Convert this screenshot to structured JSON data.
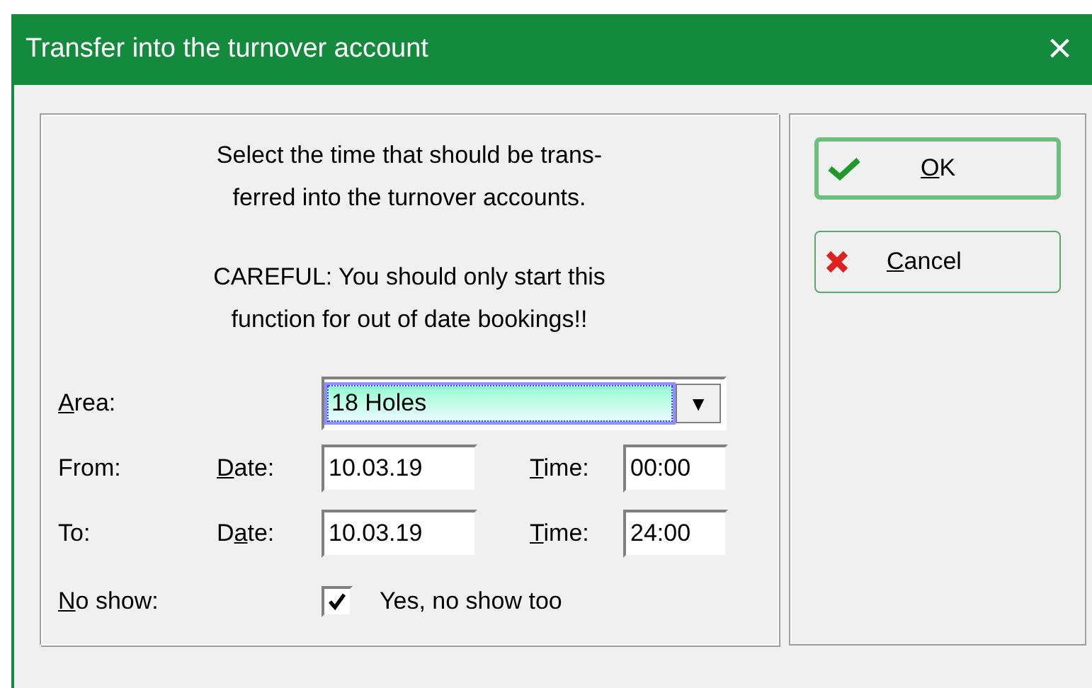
{
  "window": {
    "title": "Transfer into the turnover account",
    "close": "×"
  },
  "message": [
    [
      "Select the time that should be trans-",
      "ferred into the turnover accounts."
    ],
    [
      "CAREFUL: You should only start this",
      "function for out of date bookings!!"
    ]
  ],
  "area": {
    "label": {
      "key": "A",
      "post": "rea:"
    },
    "value": "18 Holes",
    "arrow": "▼"
  },
  "ranges": [
    {
      "label": "From:",
      "date_label": {
        "key": "D",
        "post": "ate:"
      },
      "date": "10.03.19",
      "time_label": {
        "key": "T",
        "post": "ime:"
      },
      "time": "00:00"
    },
    {
      "label": "To:",
      "date_label": {
        "pre": "D",
        "key": "a",
        "post": "te:"
      },
      "date": "10.03.19",
      "time_label": {
        "key": "T",
        "post": "ime:"
      },
      "time": "24:00"
    }
  ],
  "no_show": {
    "label": {
      "key": "N",
      "post": "o show:"
    },
    "checkbox_label": "Yes, no show too",
    "checked": true
  },
  "buttons": [
    {
      "kind": "ok",
      "label": {
        "key": "O",
        "post": "K"
      },
      "default": true
    },
    {
      "kind": "cancel",
      "label": {
        "key": "C",
        "post": "ancel"
      },
      "default": false
    }
  ]
}
